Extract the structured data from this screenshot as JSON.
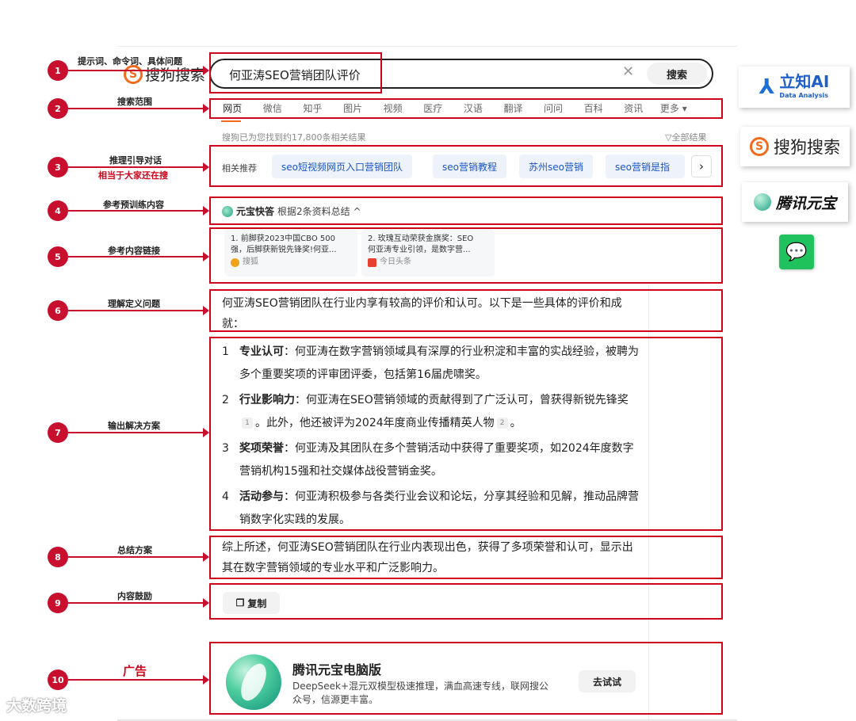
{
  "search": {
    "logo": "搜狗搜索",
    "query": "何亚涛SEO营销团队评价",
    "clear_icon": "close-icon",
    "button": "搜索"
  },
  "tabs": [
    "网页",
    "微信",
    "知乎",
    "图片",
    "视频",
    "医疗",
    "汉语",
    "翻译",
    "问问",
    "百科",
    "资讯",
    "更多 ▾"
  ],
  "result_count": "搜狗已为您找到约17,800条相关结果",
  "filter": "▽全部结果",
  "related": {
    "label": "相关推荐",
    "chips": [
      "seo短视频网页入口营销团队",
      "seo营销教程",
      "苏州seo营销",
      "seo营销是指"
    ]
  },
  "yuanbao": {
    "title": "元宝快答",
    "subtitle": "根据2条资料总结 ^"
  },
  "references": [
    {
      "line1": "1. 前脚获2023中国CBO 500",
      "line2": "强，后脚获新锐先锋奖!何亚...",
      "source": "搜狐"
    },
    {
      "line1": "2. 玫瑰互动荣获金旗奖：SEO",
      "line2": "何亚涛专业引领，是数字营...",
      "source": "今日头条"
    }
  ],
  "answer": {
    "intro": "何亚涛SEO营销团队在行业内享有较高的评价和认可。以下是一些具体的评价和成就：",
    "items": [
      {
        "num": "1",
        "head": "专业认可",
        "body_a": "：何亚涛在数字营销领域具有深厚的行业积淀和丰富的实战经验，被聘为多个重要奖项的评审团评委，包括第16届虎啸奖。",
        "body_b": "",
        "body_c": "",
        "cite1": "",
        "cite2": ""
      },
      {
        "num": "2",
        "head": "行业影响力",
        "body_a": "：何亚涛在SEO营销领域的贡献得到了广泛认可，曾获得新锐先锋奖",
        "cite1": "1",
        "body_b": "。此外，他还被评为2024年度商业传播精英人物",
        "cite2": "2",
        "body_c": "。"
      },
      {
        "num": "3",
        "head": "奖项荣誉",
        "body_a": "：何亚涛及其团队在多个营销活动中获得了重要奖项，如2024年度数字营销机构15强和社交媒体战役营销金奖。",
        "body_b": "",
        "body_c": "",
        "cite1": "",
        "cite2": ""
      },
      {
        "num": "4",
        "head": "活动参与",
        "body_a": "：何亚涛积极参与各类行业会议和论坛，分享其经验和见解，推动品牌营销数字化实践的发展。",
        "body_b": "",
        "body_c": "",
        "cite1": "",
        "cite2": ""
      }
    ],
    "summary": "综上所述，何亚涛SEO营销团队在行业内表现出色，获得了多项荣誉和认可，显示出其在数字营销领域的专业水平和广泛影响力。",
    "copy": "复制"
  },
  "ad": {
    "title": "腾讯元宝电脑版",
    "desc": "DeepSeek+混元双模型极速推理，满血高速专线，联网搜公众号，信源更丰富。",
    "button": "去试试"
  },
  "annotations": [
    {
      "num": "1",
      "label": "提示词、命令词、具体问题"
    },
    {
      "num": "2",
      "label": "搜索范围"
    },
    {
      "num": "3",
      "label": "推理引导对话",
      "sub": "相当于大家还在搜"
    },
    {
      "num": "4",
      "label": "参考预训练内容"
    },
    {
      "num": "5",
      "label": "参考内容链接"
    },
    {
      "num": "6",
      "label": "理解定义问题"
    },
    {
      "num": "7",
      "label": "输出解决方案"
    },
    {
      "num": "8",
      "label": "总结方案"
    },
    {
      "num": "9",
      "label": "内容鼓励"
    },
    {
      "num": "10",
      "label": "广告"
    }
  ],
  "side_logos": {
    "lizhi_main": "立知AI",
    "lizhi_sub": "Data Analysis",
    "sogou": "搜狗搜索",
    "yuanbao": "腾讯元宝",
    "wechat_icon": "wechat-icon"
  },
  "watermark": "大数跨境",
  "colors": {
    "annotation_red": "#d0021b",
    "link_blue": "#1a54c8",
    "accent_orange": "#f26b1d",
    "wechat_green": "#20c25d"
  }
}
